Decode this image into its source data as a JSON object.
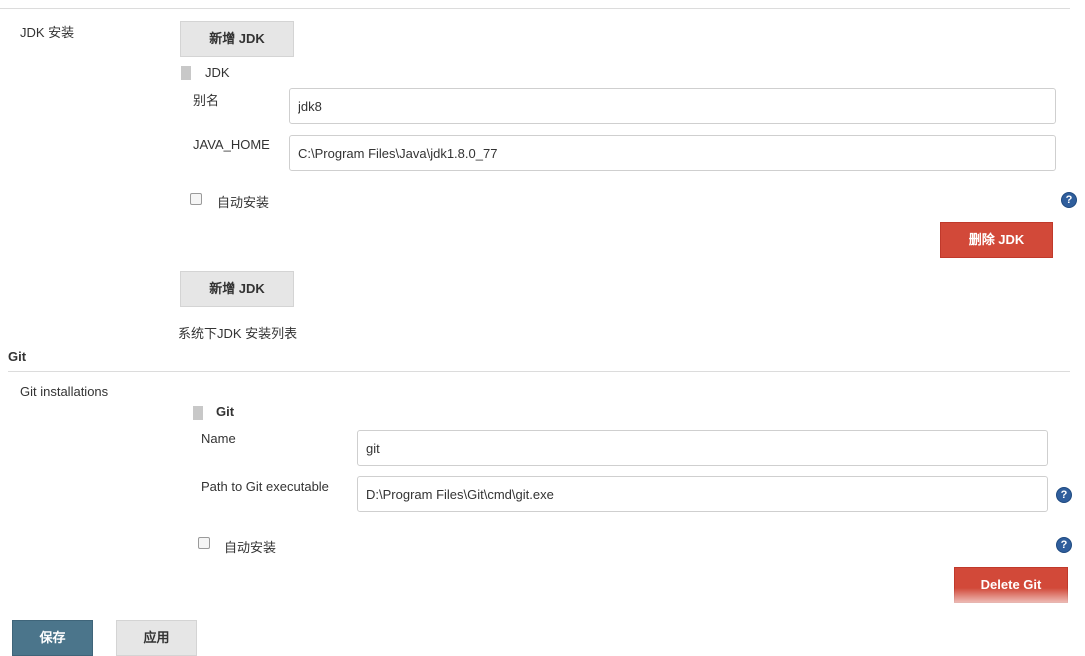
{
  "jdk": {
    "section_label": "JDK 安装",
    "add_button": "新增 JDK",
    "item_title": "JDK",
    "alias_label": "别名",
    "alias_value": "jdk8",
    "home_label": "JAVA_HOME",
    "home_value": "C:\\Program Files\\Java\\jdk1.8.0_77",
    "auto_install_label": "自动安装",
    "delete_button": "删除 JDK",
    "add_button_2": "新增 JDK",
    "list_caption": "系统下JDK 安装列表"
  },
  "git": {
    "section_title": "Git",
    "installations_label": "Git installations",
    "item_title": "Git",
    "name_label": "Name",
    "name_value": "git",
    "path_label": "Path to Git executable",
    "path_value": "D:\\Program Files\\Git\\cmd\\git.exe",
    "auto_install_label": "自动安装",
    "delete_button": "Delete Git"
  },
  "footer": {
    "save_button": "保存",
    "apply_button": "应用"
  },
  "icons": {
    "help": "?"
  },
  "colors": {
    "delete_red": "#d24939",
    "save_blue": "#4b758b",
    "help_blue": "#2f5e9c"
  }
}
